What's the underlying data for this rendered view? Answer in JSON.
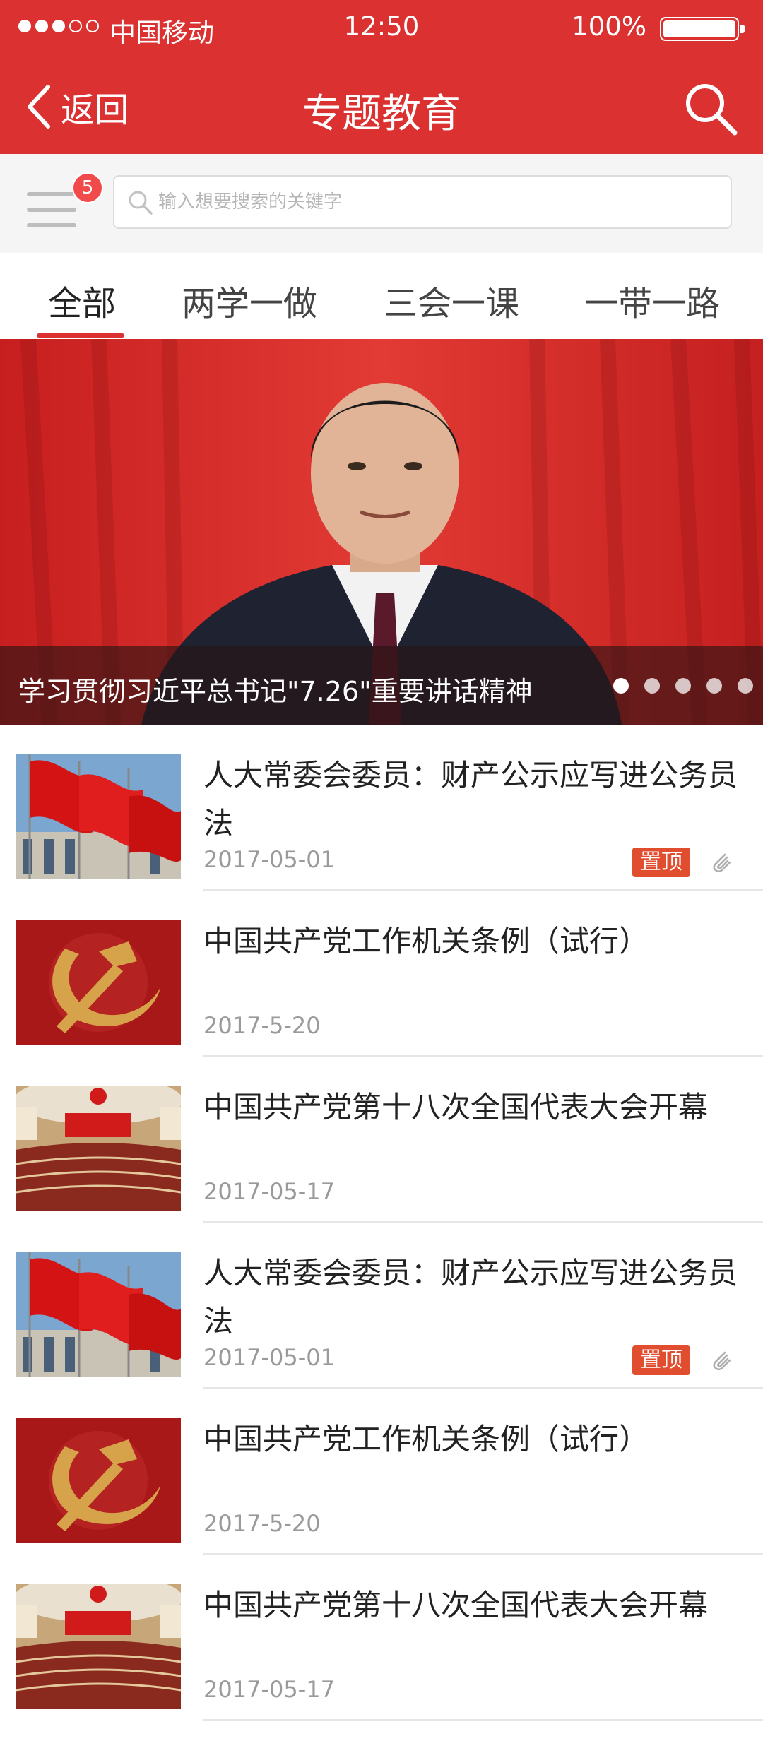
{
  "status_bar": {
    "carrier": "中国移动",
    "time": "12:50",
    "battery": "100%",
    "signal_bars_filled": 3,
    "signal_bars_total": 5
  },
  "nav": {
    "back_label": "返回",
    "title": "专题教育"
  },
  "search": {
    "badge_count": "5",
    "placeholder": "输入想要搜索的关键字"
  },
  "tabs": [
    {
      "label": "全部",
      "active": true
    },
    {
      "label": "两学一做",
      "active": false
    },
    {
      "label": "三会一课",
      "active": false
    },
    {
      "label": "一带一路",
      "active": false
    }
  ],
  "banner": {
    "caption": "学习贯彻习近平总书记\"7.26\"重要讲话精神",
    "page_count": 5,
    "active_page": 1
  },
  "news": [
    {
      "title": "人大常委会委员：财产公示应写进公务员法",
      "date": "2017-05-01",
      "pinned_label": "置顶",
      "has_attachment": true,
      "thumb": "flags"
    },
    {
      "title": "中国共产党工作机关条例（试行）",
      "date": "2017-5-20",
      "thumb": "hammer-sickle"
    },
    {
      "title": "中国共产党第十八次全国代表大会开幕",
      "date": "2017-05-17",
      "thumb": "congress-hall"
    },
    {
      "title": "人大常委会委员：财产公示应写进公务员法",
      "date": "2017-05-01",
      "pinned_label": "置顶",
      "has_attachment": true,
      "thumb": "flags"
    },
    {
      "title": "中国共产党工作机关条例（试行）",
      "date": "2017-5-20",
      "thumb": "hammer-sickle"
    },
    {
      "title": "中国共产党第十八次全国代表大会开幕",
      "date": "2017-05-17",
      "thumb": "congress-hall"
    }
  ],
  "colors": {
    "brand_red": "#db3131",
    "pin_orange": "#e04d2f",
    "date_gray": "#9a9a9a"
  }
}
